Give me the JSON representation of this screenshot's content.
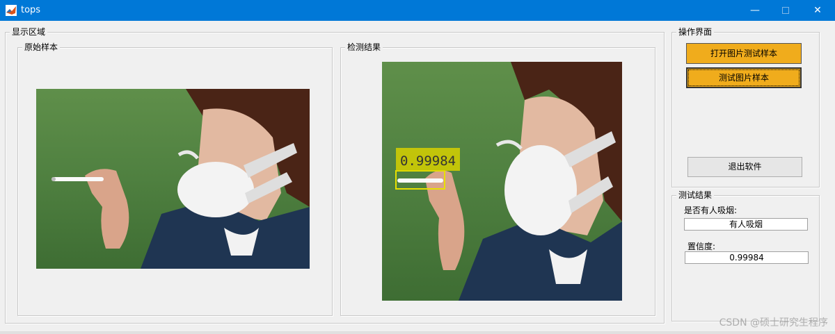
{
  "window": {
    "title": "tops",
    "minimize": "—",
    "close": "✕"
  },
  "display_area": {
    "title": "显示区域",
    "original": {
      "title": "原始样本"
    },
    "result": {
      "title": "检测结果",
      "detection_score": "0.99984"
    }
  },
  "operations": {
    "title": "操作界面",
    "open_button": "打开图片测试样本",
    "test_button": "测试图片样本",
    "exit_button": "退出软件"
  },
  "test_results": {
    "title": "测试结果",
    "smoking_label": "是否有人吸烟:",
    "smoking_value": "有人吸烟",
    "confidence_label": "置信度:",
    "confidence_value": "0.99984"
  },
  "watermark": "CSDN @硕士研究生程序",
  "colors": {
    "titlebar": "#0078d7",
    "button_accent": "#f0ac1c",
    "detection_box": "#e8e000"
  }
}
